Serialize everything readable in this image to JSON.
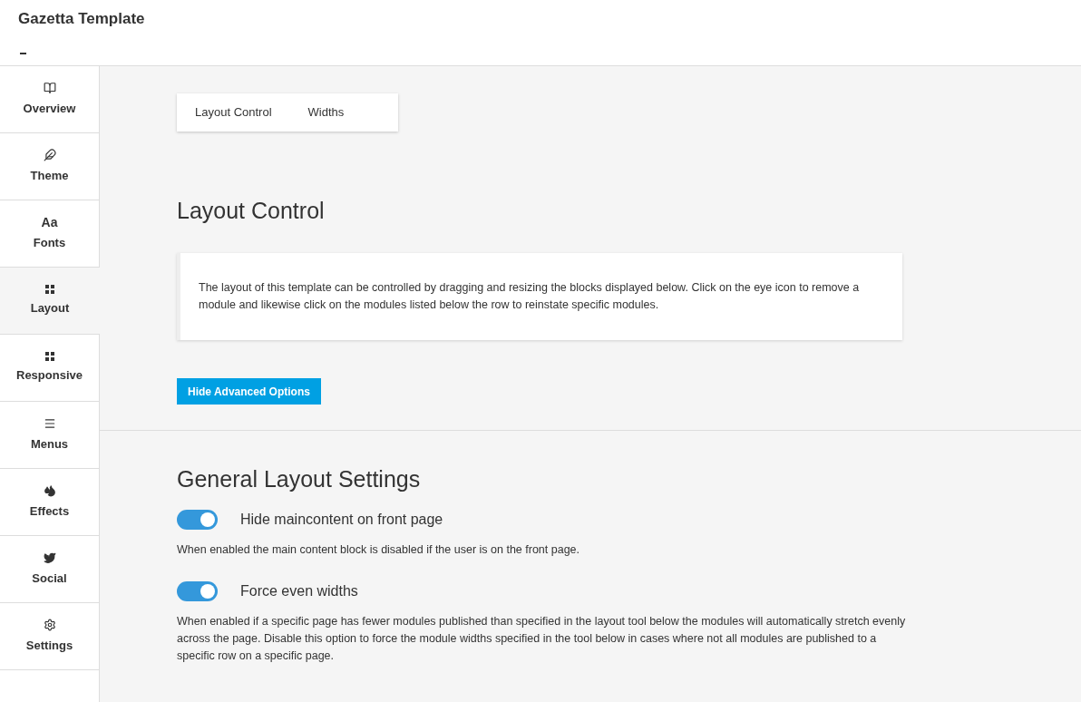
{
  "header": {
    "title": "Gazetta Template"
  },
  "sidebar": {
    "items": [
      {
        "label": "Overview",
        "kind": "book",
        "selected": false
      },
      {
        "label": "Theme",
        "kind": "feather",
        "selected": false
      },
      {
        "label": "Fonts",
        "kind": "glyph",
        "glyph": "Aa",
        "selected": false
      },
      {
        "label": "Layout",
        "kind": "grid",
        "selected": true
      },
      {
        "label": "Responsive",
        "kind": "grid",
        "selected": false
      },
      {
        "label": "Menus",
        "kind": "menu",
        "selected": false
      },
      {
        "label": "Effects",
        "kind": "drops",
        "selected": false
      },
      {
        "label": "Social",
        "kind": "bird",
        "selected": false
      },
      {
        "label": "Settings",
        "kind": "gear",
        "selected": false
      }
    ]
  },
  "tabs": [
    {
      "label": "Layout Control"
    },
    {
      "label": "Widths"
    }
  ],
  "section": {
    "title": "Layout Control",
    "description": "The layout of this template can be controlled by dragging and resizing the blocks displayed below. Click on the eye icon to remove a module and likewise click on the modules listed below the row to reinstate specific modules.",
    "button": "Hide Advanced Options"
  },
  "general": {
    "title": "General Layout Settings",
    "settings": [
      {
        "label": "Hide maincontent on front page",
        "on": true,
        "description": "When enabled the main content block is disabled if the user is on the front page."
      },
      {
        "label": "Force even widths",
        "on": true,
        "description": "When enabled if a specific page has fewer modules published than specified in the layout tool below the modules will automatically stretch evenly across the page. Disable this option to force the module widths specified in the tool below in cases where not all modules are published to a specific row on a specific page."
      }
    ]
  }
}
